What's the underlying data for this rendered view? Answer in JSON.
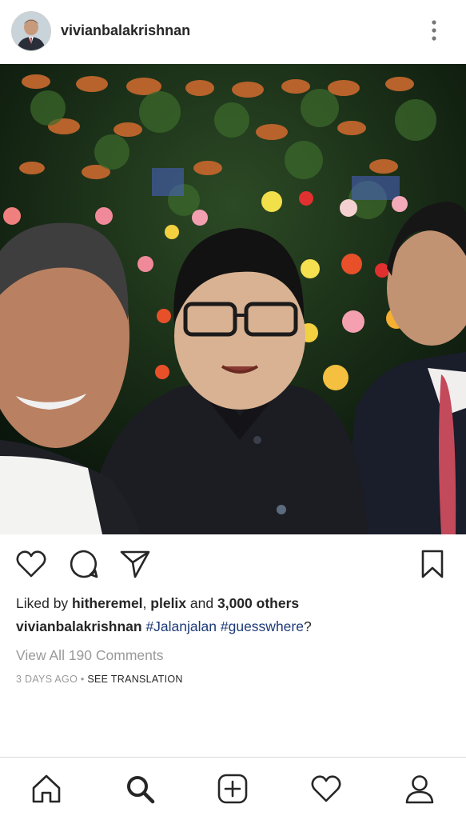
{
  "header": {
    "username": "vivianbalakrishnan",
    "more_icon": "more-vertical-icon"
  },
  "actions": {
    "like_icon": "heart-icon",
    "comment_icon": "comment-icon",
    "share_icon": "send-icon",
    "save_icon": "bookmark-icon"
  },
  "post": {
    "liked_by_prefix": "Liked by ",
    "liked_user_1": "hitheremel",
    "separator": ", ",
    "liked_user_2": "plelix",
    "and_text": " and ",
    "others_count": "3,000 others",
    "caption_user": "vivianbalakrishnan",
    "hashtag_1": "#Jalanjalan",
    "hashtag_2": "#guesswhere",
    "caption_suffix": "?",
    "view_comments": "View All 190 Comments",
    "time_ago": "3 DAYS AGO",
    "meta_sep": " • ",
    "see_translation": "SEE TRANSLATION"
  },
  "bottom_nav": [
    {
      "icon": "home-icon"
    },
    {
      "icon": "search-icon"
    },
    {
      "icon": "add-post-icon"
    },
    {
      "icon": "activity-heart-icon"
    },
    {
      "icon": "profile-icon"
    }
  ],
  "colors": {
    "hashtag": "#1d3a78",
    "muted": "#9a9a9a",
    "text": "#262626"
  }
}
